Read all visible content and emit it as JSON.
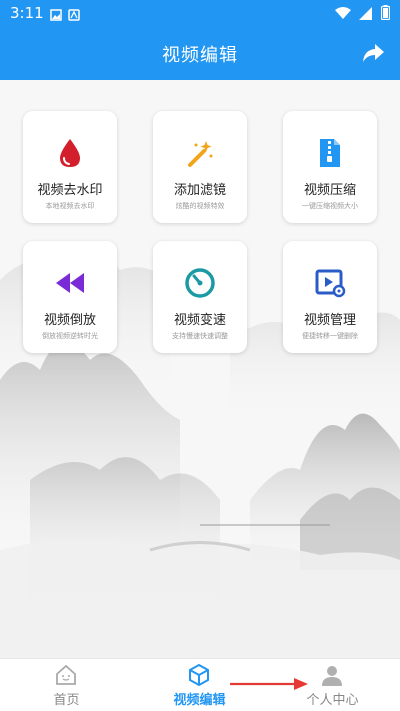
{
  "status_bar": {
    "time": "3:11"
  },
  "header": {
    "title": "视频编辑"
  },
  "tiles": [
    {
      "name": "视频去水印",
      "desc": "本地视频去水印",
      "icon": "water-drop-icon",
      "color": "#d21f2b"
    },
    {
      "name": "添加滤镜",
      "desc": "炫酷的视频特效",
      "icon": "magic-wand-icon",
      "color": "#f2a51a"
    },
    {
      "name": "视频压缩",
      "desc": "一键压缩视频大小",
      "icon": "zip-file-icon",
      "color": "#2196F3"
    },
    {
      "name": "视频倒放",
      "desc": "倒放视频逆转时光",
      "icon": "rewind-icon",
      "color": "#7a2ad6"
    },
    {
      "name": "视频变速",
      "desc": "支持慢速快速调整",
      "icon": "speed-dial-icon",
      "color": "#1c9aa3"
    },
    {
      "name": "视频管理",
      "desc": "便捷转移一键删除",
      "icon": "video-settings-icon",
      "color": "#2a5cc7"
    }
  ],
  "tabs": [
    {
      "label": "首页",
      "icon": "home-icon"
    },
    {
      "label": "视频编辑",
      "icon": "cube-icon"
    },
    {
      "label": "个人中心",
      "icon": "person-icon"
    }
  ],
  "accent_color": "#2196F3",
  "annotation_arrow_color": "#e53935"
}
